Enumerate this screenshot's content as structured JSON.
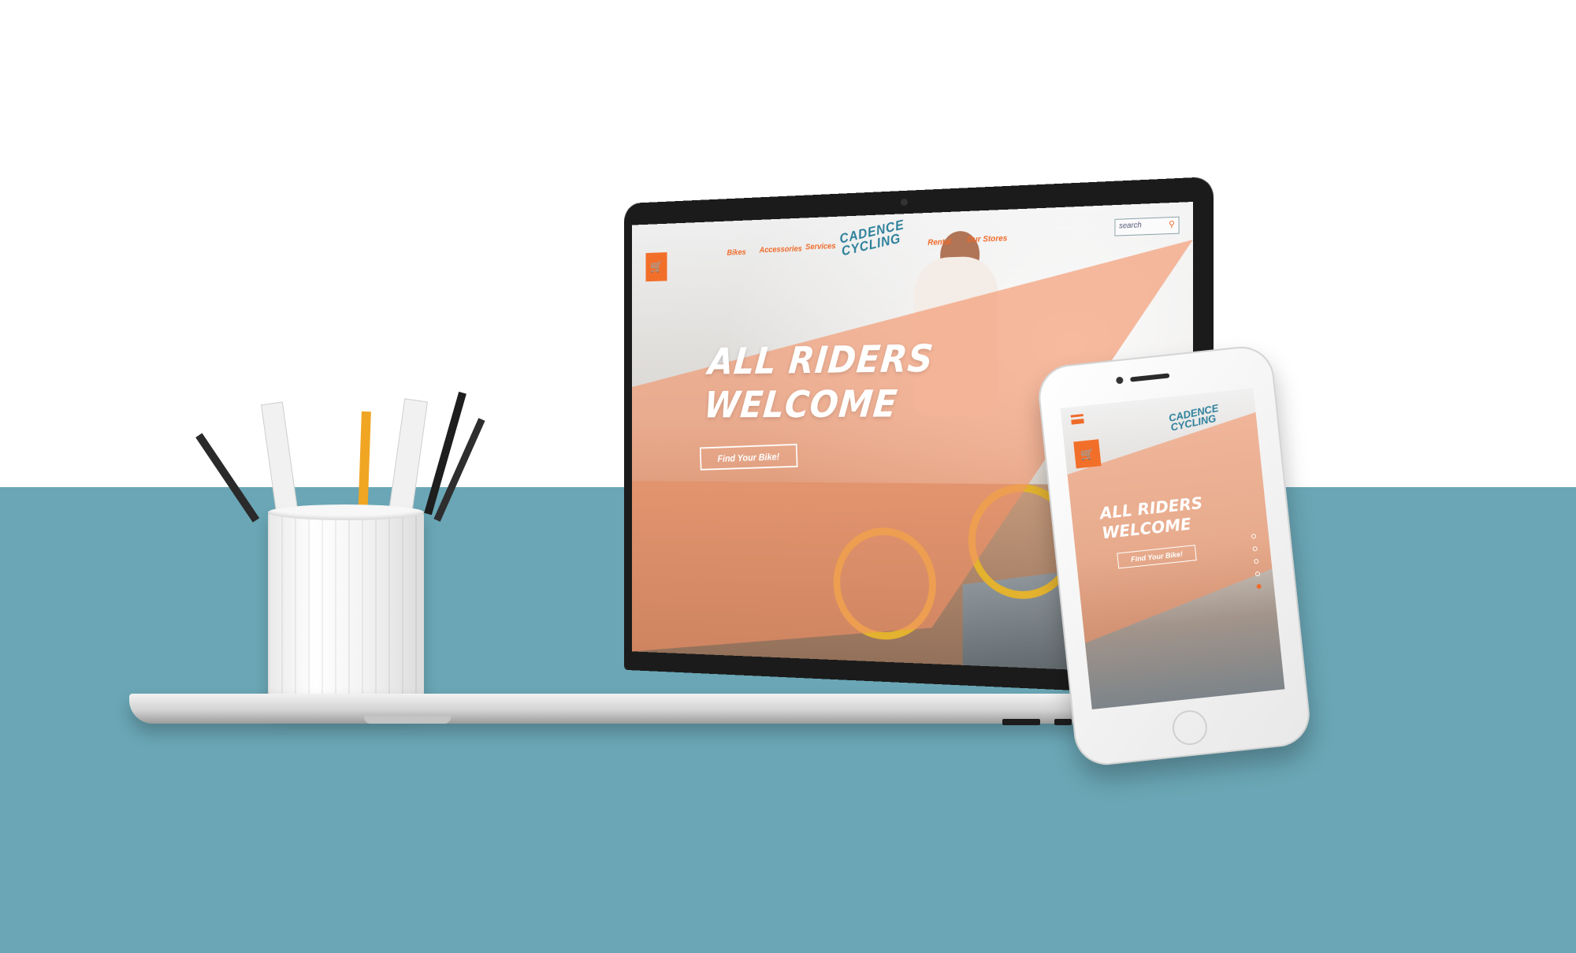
{
  "laptop_site": {
    "nav": {
      "links_left": [
        "Bikes",
        "Accessories",
        "Services"
      ],
      "links_right": [
        "Rental",
        "Our Stores"
      ],
      "logo_line1": "CADENCE",
      "logo_line2": "CYCLING",
      "search_placeholder": "search",
      "search_icon": "search-icon",
      "cart_icon": "cart-icon"
    },
    "hero": {
      "title_line1": "ALL RIDERS",
      "title_line2": "WELCOME",
      "cta_label": "Find Your Bike!"
    }
  },
  "phone_site": {
    "logo_line1": "CADENCE",
    "logo_line2": "CYCLING",
    "menu_icon": "hamburger-menu-icon",
    "cart_icon": "cart-icon",
    "hero": {
      "title_line1": "ALL RIDERS",
      "title_line2": "WELCOME",
      "cta_label": "Find Your Bike!"
    },
    "slide_dots_count": 5,
    "active_slide": 5
  },
  "colors": {
    "accent_orange": "#ef6b2a",
    "logo_teal": "#2b7f9a",
    "background_teal": "#6aa6b5"
  }
}
